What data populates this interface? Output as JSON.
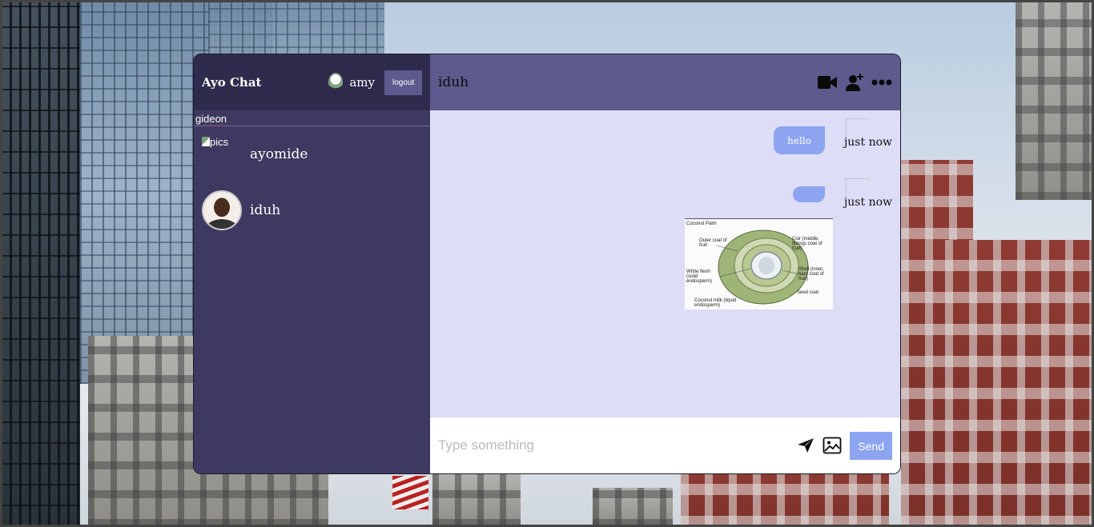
{
  "app": {
    "title": "Ayo Chat",
    "current_user": "amy",
    "logout_label": "logout"
  },
  "search": {
    "value": "gideon"
  },
  "contacts": [
    {
      "name": "ayomide",
      "image_alt": "pics"
    },
    {
      "name": "iduh"
    }
  ],
  "chat": {
    "active_name": "iduh",
    "icons": [
      "video-icon",
      "add-user-icon",
      "more-icon"
    ],
    "messages": [
      {
        "text": "hello",
        "time": "just now"
      },
      {
        "text": "",
        "time": "just now"
      }
    ],
    "image_labels": {
      "title": "Coconut Palm",
      "outer": "Outer coat of fruit",
      "coir": "Coir (middle, fibrous coat of fruit)",
      "white": "White flesh (solid endosperm)",
      "shell": "Shell (inner, hard coat of fruit)",
      "seed": "Seed coat",
      "milk": "Coconut milk (liquid endosperm)"
    }
  },
  "composer": {
    "placeholder": "Type something",
    "send_label": "Send"
  },
  "colors": {
    "sidebar": "#3d3960",
    "navbar": "#2e2b4d",
    "chat_header": "#5d5b8d",
    "messages_bg": "#ddddf7",
    "bubble": "#8da4f1"
  }
}
